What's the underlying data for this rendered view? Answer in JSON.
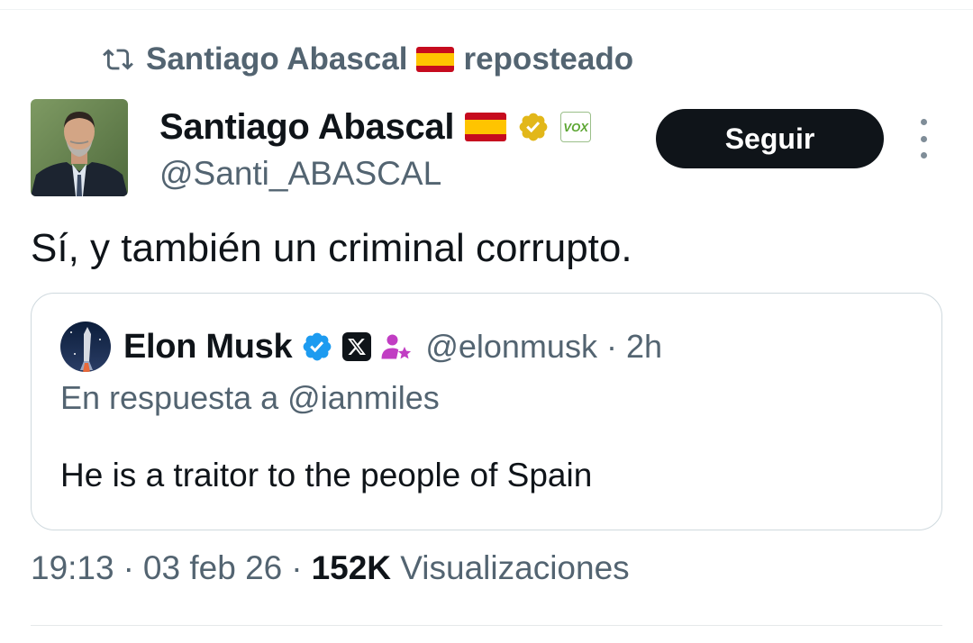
{
  "repost": {
    "name": "Santiago Abascal",
    "label": "reposteado"
  },
  "author": {
    "name": "Santiago Abascal",
    "handle": "@Santi_ABASCAL",
    "badge_text": "VOX"
  },
  "follow": {
    "label": "Seguir"
  },
  "tweet": {
    "text": "Sí, y también un criminal corrupto."
  },
  "quote": {
    "name": "Elon Musk",
    "handle": "@elonmusk",
    "separator": "·",
    "time": "2h",
    "reply_to": "En respuesta a @ianmiles",
    "text": "He is a traitor to the people of Spain"
  },
  "meta": {
    "time": "19:13",
    "date": "03 feb 26",
    "separator": "·",
    "views_count": "152K",
    "views_label": "Visualizaciones"
  },
  "icons": {
    "repost": "repost-icon",
    "flag": "spain-flag-icon",
    "verified_gold": "verified-gold-icon",
    "verified_blue": "verified-blue-icon",
    "x_logo": "x-logo-icon",
    "affiliate": "affiliate-person-icon",
    "more": "more-vertical-icon"
  },
  "colors": {
    "text_primary": "#0f1419",
    "text_secondary": "#536471",
    "verified_blue": "#1d9bf0",
    "verified_gold": "#e2b719",
    "follow_button_bg": "#0f1419",
    "affiliate_pink": "#c13dc3",
    "border": "#cfd9de"
  }
}
